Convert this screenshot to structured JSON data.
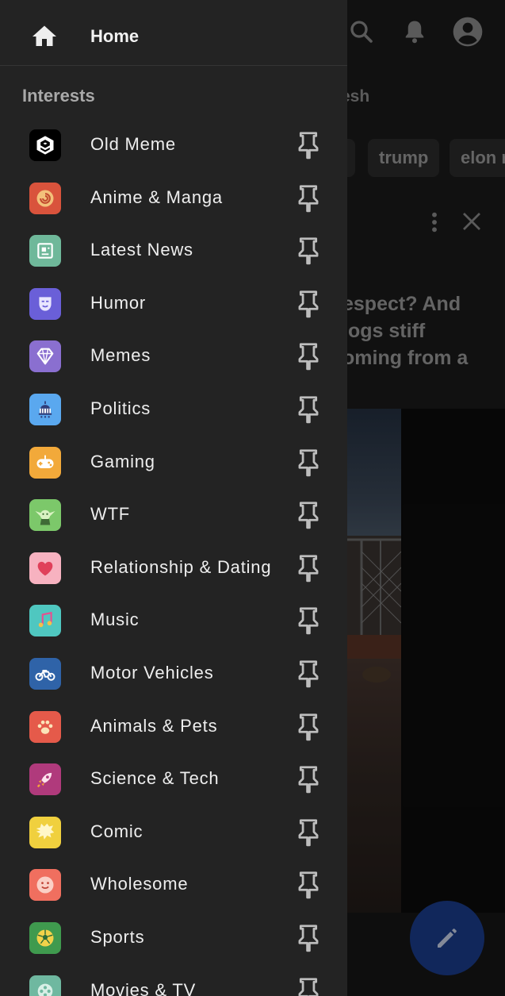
{
  "background": {
    "fresh_text": "esh",
    "chips": [
      "trump",
      "elon r"
    ],
    "post_title_lines": [
      "espect? And",
      "logs stiff",
      "oming from a"
    ]
  },
  "drawer": {
    "home_label": "Home",
    "section_title": "Interests",
    "items": [
      {
        "label": "Old Meme",
        "icon": "9gag-icon",
        "color": "#000000"
      },
      {
        "label": "Anime & Manga",
        "icon": "naruto-swirl-icon",
        "color": "#d9533c"
      },
      {
        "label": "Latest News",
        "icon": "newspaper-icon",
        "color": "#6fb89a"
      },
      {
        "label": "Humor",
        "icon": "mask-icon",
        "color": "#6a5fd8"
      },
      {
        "label": "Memes",
        "icon": "diamond-icon",
        "color": "#8a6fd0"
      },
      {
        "label": "Politics",
        "icon": "capitol-icon",
        "color": "#5aa8ef"
      },
      {
        "label": "Gaming",
        "icon": "gamepad-icon",
        "color": "#f2a93a"
      },
      {
        "label": "WTF",
        "icon": "yoda-icon",
        "color": "#7cc86a"
      },
      {
        "label": "Relationship & Dating",
        "icon": "heart-icon",
        "color": "#f7b2c0"
      },
      {
        "label": "Music",
        "icon": "music-note-icon",
        "color": "#4fc7c0"
      },
      {
        "label": "Motor Vehicles",
        "icon": "motorcycle-icon",
        "color": "#2f63a8"
      },
      {
        "label": "Animals & Pets",
        "icon": "paw-icon",
        "color": "#e55a4a"
      },
      {
        "label": "Science & Tech",
        "icon": "rocket-icon",
        "color": "#b03a7c"
      },
      {
        "label": "Comic",
        "icon": "speech-burst-icon",
        "color": "#f0d03e"
      },
      {
        "label": "Wholesome",
        "icon": "smiley-icon",
        "color": "#f06f5f"
      },
      {
        "label": "Sports",
        "icon": "soccer-ball-icon",
        "color": "#3f9a4e"
      },
      {
        "label": "Movies & TV",
        "icon": "film-reel-icon",
        "color": "#6fb8a0"
      }
    ]
  },
  "colors": {
    "drawer_bg": "#232323",
    "fab": "#1b3c8c"
  }
}
